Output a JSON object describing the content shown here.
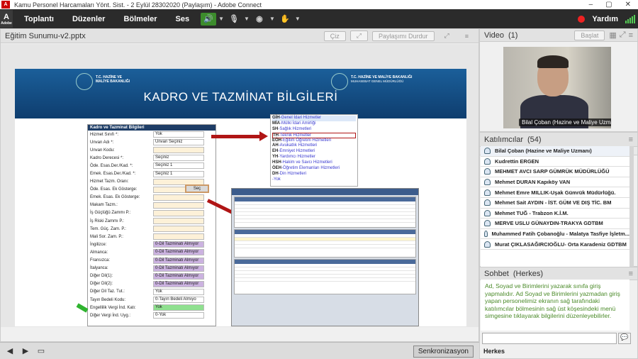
{
  "window": {
    "title": "Kamu Personel Harcamaları Yönt. Sist. - 2 Eylül 28302020 (Paylaşım) - Adobe Connect",
    "adobe_label": "Adobe"
  },
  "menu": {
    "items": [
      "Toplantı",
      "Düzenler",
      "Bölmeler",
      "Ses"
    ],
    "help": "Yardım"
  },
  "share_pod": {
    "title": "Eğitim Sunumu-v2.pptx",
    "buttons": [
      "Çiz",
      "Paylaşımı Durdur"
    ],
    "sync_label": "Senkronizasyon"
  },
  "slide": {
    "title": "KADRO VE TAZMİNAT BİLGİLERİ",
    "logo_left": [
      "T.C. HAZİNE VE",
      "MALİYE BAKANLIĞI"
    ],
    "logo_right": [
      "T.C. HAZİNE VE MALİYE BAKANLIĞI",
      "MUHASEBAT GENEL MÜDÜRLÜĞÜ"
    ],
    "form_title": "Kadro ve Tazminat Bilgileri",
    "form_rows": [
      {
        "label": "Hizmet Sınıfı *:",
        "value": "Yok",
        "style": "wh"
      },
      {
        "label": "Unvan Adı *:",
        "value": "Unvan Seçiniz",
        "style": "wh"
      },
      {
        "label": "Unvan Kodu:",
        "value": "",
        "style": ""
      },
      {
        "label": "Kadro Derecesi *:",
        "value": "Seçiniz",
        "style": "wh"
      },
      {
        "label": "Öde. Esas.Der./Kad. *:",
        "value": "Seçiniz     1",
        "style": "wh"
      },
      {
        "label": "Emek. Esas.Der./Kad. *:",
        "value": "Seçiniz     1",
        "style": "wh"
      },
      {
        "label": "Hizmet Tazm. Oranı:",
        "value": "",
        "style": ""
      },
      {
        "label": "Öde. Esas. Ek Gösterge:",
        "value": "",
        "style": ""
      },
      {
        "label": "Emek. Esas. Ek Gösterge:",
        "value": "",
        "style": ""
      },
      {
        "label": "Makam Tazm.:",
        "value": "",
        "style": ""
      },
      {
        "label": "İş Güçlüğü Zammı P.:",
        "value": "",
        "style": ""
      },
      {
        "label": "İş Riski Zammı P.:",
        "value": "",
        "style": ""
      },
      {
        "label": "Tem. Güç. Zam. P.:",
        "value": "",
        "style": ""
      },
      {
        "label": "Mali Sor. Zam. P.:",
        "value": "",
        "style": ""
      },
      {
        "label": "İngilizce:",
        "value": "0-Dil Tazminatı Almıyor",
        "style": "pur"
      },
      {
        "label": "Almanca:",
        "value": "0-Dil Tazminatı Almıyor",
        "style": "pur"
      },
      {
        "label": "Fransızca:",
        "value": "0-Dil Tazminatı Almıyor",
        "style": "pur"
      },
      {
        "label": "İtalyanca:",
        "value": "0-Dil Tazminatı Almıyor",
        "style": "pur"
      },
      {
        "label": "Diğer Dil(1):",
        "value": "0-Dil Tazminatı Almıyor",
        "style": "pur"
      },
      {
        "label": "Diğer Dil(2):",
        "value": "0-Dil Tazminatı Almıyor",
        "style": "pur"
      },
      {
        "label": "Diğer Dil Taz. Tut.:",
        "value": "Yok",
        "style": "wh"
      },
      {
        "label": "Tayın Bedeli Kodu:",
        "value": "0-Tayın Bedeli Almıyo",
        "style": "wh"
      },
      {
        "label": "Engellilik Vergi İnd. Katı:",
        "value": "Yok",
        "style": "grn"
      },
      {
        "label": "Diğer Vergi İnd. Uyg.:",
        "value": "0-Yok",
        "style": "wh"
      }
    ],
    "seek_button": "Seç",
    "hizmet_list": [
      {
        "code": "GİH",
        "text": "-Genel İdari Hizmetler"
      },
      {
        "code": "MİA",
        "text": "-Mülki İdari Amirliği"
      },
      {
        "code": "SH",
        "text": "-Sağlık Hizmetleri"
      },
      {
        "code": "TH",
        "text": "-Teknik Hizmetler"
      },
      {
        "code": "EÖH",
        "text": "-Eğitim Öğretim Hizmetleri"
      },
      {
        "code": "AH",
        "text": "-Avukatlık Hizmetleri"
      },
      {
        "code": "EH",
        "text": "-Emniyet Hizmetleri"
      },
      {
        "code": "YH",
        "text": "-Yardımcı Hizmetler"
      },
      {
        "code": "HSH",
        "text": "-Hakim ve Savcı Hizmetleri"
      },
      {
        "code": "ÖEH",
        "text": "-Öğretim Elemanları Hizmetleri"
      },
      {
        "code": "DH",
        "text": "-Din Hizmetleri"
      },
      {
        "code": "",
        "text": "-Yok"
      }
    ]
  },
  "video_pod": {
    "title": "Video",
    "count": "(1)",
    "start_button": "Başlat",
    "speaker": "Bilal Çoban (Hazine ve Maliye Uzmanı)"
  },
  "attendees_pod": {
    "title": "Katılımcılar",
    "count": "(54)",
    "participants": [
      "Bilal Çoban (Hazine ve Maliye Uzmanı)",
      "Kudrettin ERGEN",
      "MEHMET AVCI SARP GÜMRÜK MÜDÜRLÜĞÜ",
      "Mehmet DURAN Kapıköy VAN",
      "Mehmet Emre MILLIK-Uşak Gümrük Müdürlüğü.",
      "Mehmet Sait AYDIN - İST. GÜM VE DIŞ TİC. BM",
      "Mehmet TUĞ - Trabzon K.İ.M.",
      "MERVE USLU GÜNAYDIN-TRAKYA GDTBM",
      "Muhammed Fatih Çobanoğlu - Malatya Tasfiye İşletm...",
      "Murat ÇIKLASAĞIRCIOĞLU- Orta Karadeniz GDTBM"
    ]
  },
  "chat_pod": {
    "title": "Sohbet",
    "scope": "(Herkes)",
    "message": "Ad, Soyad ve Birimlerini yazarak sınıfa giriş yapmalıdır. Ad Soyad ve Birimlerini yazmadan giriş yapan personelimiz ekranın sağ tarafındaki katılımcılar bölmesinin sağ üst köşesindeki menü simgesine tıklayarak bilgilerini düzenleyebilirler.",
    "recipient": "Herkes"
  }
}
